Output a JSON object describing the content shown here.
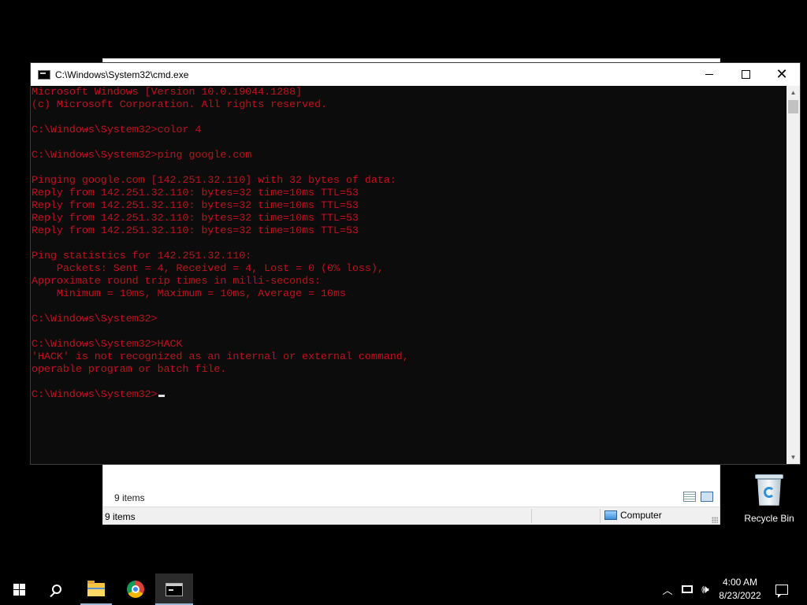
{
  "explorer": {
    "items_label": "9 items",
    "status_items": "9 items",
    "status_location": "Computer"
  },
  "cmd": {
    "title": "C:\\Windows\\System32\\cmd.exe",
    "lines": [
      "Microsoft Windows [Version 10.0.19044.1288]",
      "(c) Microsoft Corporation. All rights reserved.",
      "",
      "C:\\Windows\\System32>color 4",
      "",
      "C:\\Windows\\System32>ping google.com",
      "",
      "Pinging google.com [142.251.32.110] with 32 bytes of data:",
      "Reply from 142.251.32.110: bytes=32 time=10ms TTL=53",
      "Reply from 142.251.32.110: bytes=32 time=10ms TTL=53",
      "Reply from 142.251.32.110: bytes=32 time=10ms TTL=53",
      "Reply from 142.251.32.110: bytes=32 time=10ms TTL=53",
      "",
      "Ping statistics for 142.251.32.110:",
      "    Packets: Sent = 4, Received = 4, Lost = 0 (0% loss),",
      "Approximate round trip times in milli-seconds:",
      "    Minimum = 10ms, Maximum = 10ms, Average = 10ms",
      "",
      "C:\\Windows\\System32>",
      "",
      "C:\\Windows\\System32>HACK",
      "'HACK' is not recognized as an internal or external command,",
      "operable program or batch file.",
      "",
      "C:\\Windows\\System32>"
    ],
    "text_color": "#c50f1f",
    "background": "#0c0c0c"
  },
  "desktop": {
    "recycle_bin_label": "Recycle Bin"
  },
  "taskbar": {
    "time": "4:00 AM",
    "date": "8/23/2022",
    "icons": [
      "windows-start-icon",
      "search-icon",
      "file-explorer-icon",
      "chrome-icon",
      "cmd-icon"
    ]
  }
}
